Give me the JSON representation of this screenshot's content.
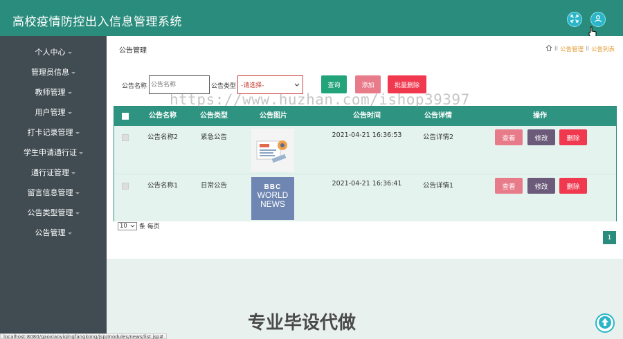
{
  "app": {
    "title": "高校疫情防控出入信息管理系统"
  },
  "sidebar": {
    "items": [
      {
        "label": "个人中心"
      },
      {
        "label": "管理员信息"
      },
      {
        "label": "教师管理"
      },
      {
        "label": "用户管理"
      },
      {
        "label": "打卡记录管理"
      },
      {
        "label": "学生申请通行证"
      },
      {
        "label": "通行证管理"
      },
      {
        "label": "留言信息管理"
      },
      {
        "label": "公告类型管理"
      },
      {
        "label": "公告管理"
      }
    ]
  },
  "page": {
    "title": "公告管理",
    "breadcrumb": {
      "sep": "II",
      "module": "公告管理",
      "current": "公告列表"
    }
  },
  "filters": {
    "name_label": "公告名称",
    "name_placeholder": "公告名称",
    "type_label": "公告类型",
    "type_selected": "-请选择-",
    "search_btn": "查询",
    "add_btn": "添加",
    "batch_delete_btn": "批量删除"
  },
  "table": {
    "headers": [
      "公告名称",
      "公告类型",
      "公告图片",
      "公告时间",
      "公告详情",
      "操作"
    ],
    "rows": [
      {
        "name": "公告名称2",
        "type": "紧急公告",
        "image": "news-illustration",
        "time": "2021-04-21 16:36:53",
        "detail": "公告详情2"
      },
      {
        "name": "公告名称1",
        "type": "日常公告",
        "image": "bbc-world-news-logo",
        "time": "2021-04-21 16:36:41",
        "detail": "公告详情1"
      }
    ],
    "actions": {
      "view": "查看",
      "edit": "修改",
      "delete": "删除"
    },
    "bbc_logo": {
      "line1": "BBC",
      "line2": "WORLD",
      "line3": "NEWS"
    }
  },
  "pagination": {
    "page_size": "10",
    "per_page_label": "条 每页",
    "current_page": "1"
  },
  "status_bar": "localhost:8080/gaoxiaoyiqingfangkong/jsp/modules/news/list.jsp#",
  "watermark": "https://www.huzhan.com/ishop39397",
  "promo_text": "专业毕设代做",
  "colors": {
    "topbar": "#2a8c7c",
    "sidebar": "#414c52",
    "table_header": "#2e9380",
    "btn_search": "#23a37a",
    "btn_add": "#e87b8a",
    "btn_batch_delete": "#f0384f",
    "btn_view": "#e87b8a",
    "btn_edit": "#6b5a7a",
    "btn_delete": "#f0384f"
  },
  "icons": [
    "fullscreen-icon",
    "user-icon",
    "home-icon",
    "arrow-up-icon"
  ]
}
